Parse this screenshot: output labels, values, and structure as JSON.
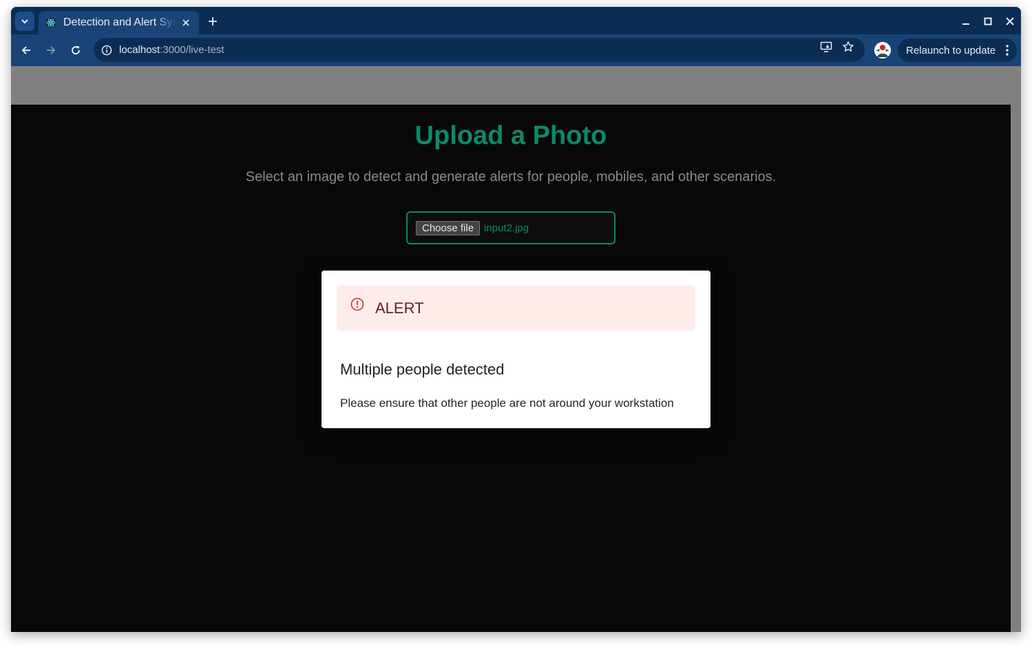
{
  "browser": {
    "tab_title": "Detection and Alert System",
    "url_host": "localhost",
    "url_path": ":3000/live-test",
    "relaunch_label": "Relaunch to update"
  },
  "page": {
    "heading": "Upload a Photo",
    "subtitle": "Select an image to detect and generate alerts for people, mobiles, and other scenarios.",
    "file_button": "Choose file",
    "file_name": "input2.jpg"
  },
  "modal": {
    "alert_title": "ALERT",
    "title": "Multiple people detected",
    "message": "Please ensure that other people are not around your workstation"
  },
  "colors": {
    "accent": "#0d8a66",
    "alert_bg": "#fdecea",
    "alert_text": "#5f2120",
    "alert_icon": "#d32f2f",
    "chrome_dark": "#0b2d54",
    "chrome_mid": "#1a4477"
  }
}
